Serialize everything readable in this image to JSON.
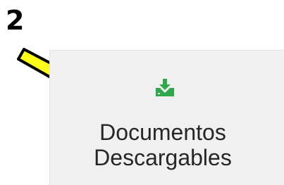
{
  "annotation": {
    "step_number": "2",
    "arrow_color": "#ffff1a",
    "arrow_icon": "arrow-pointer-icon"
  },
  "tile": {
    "icon": "download-icon",
    "icon_color": "#2ea84a",
    "label_line1": "Documentos",
    "label_line2": "Descargables",
    "background": "#f0f0f0"
  }
}
